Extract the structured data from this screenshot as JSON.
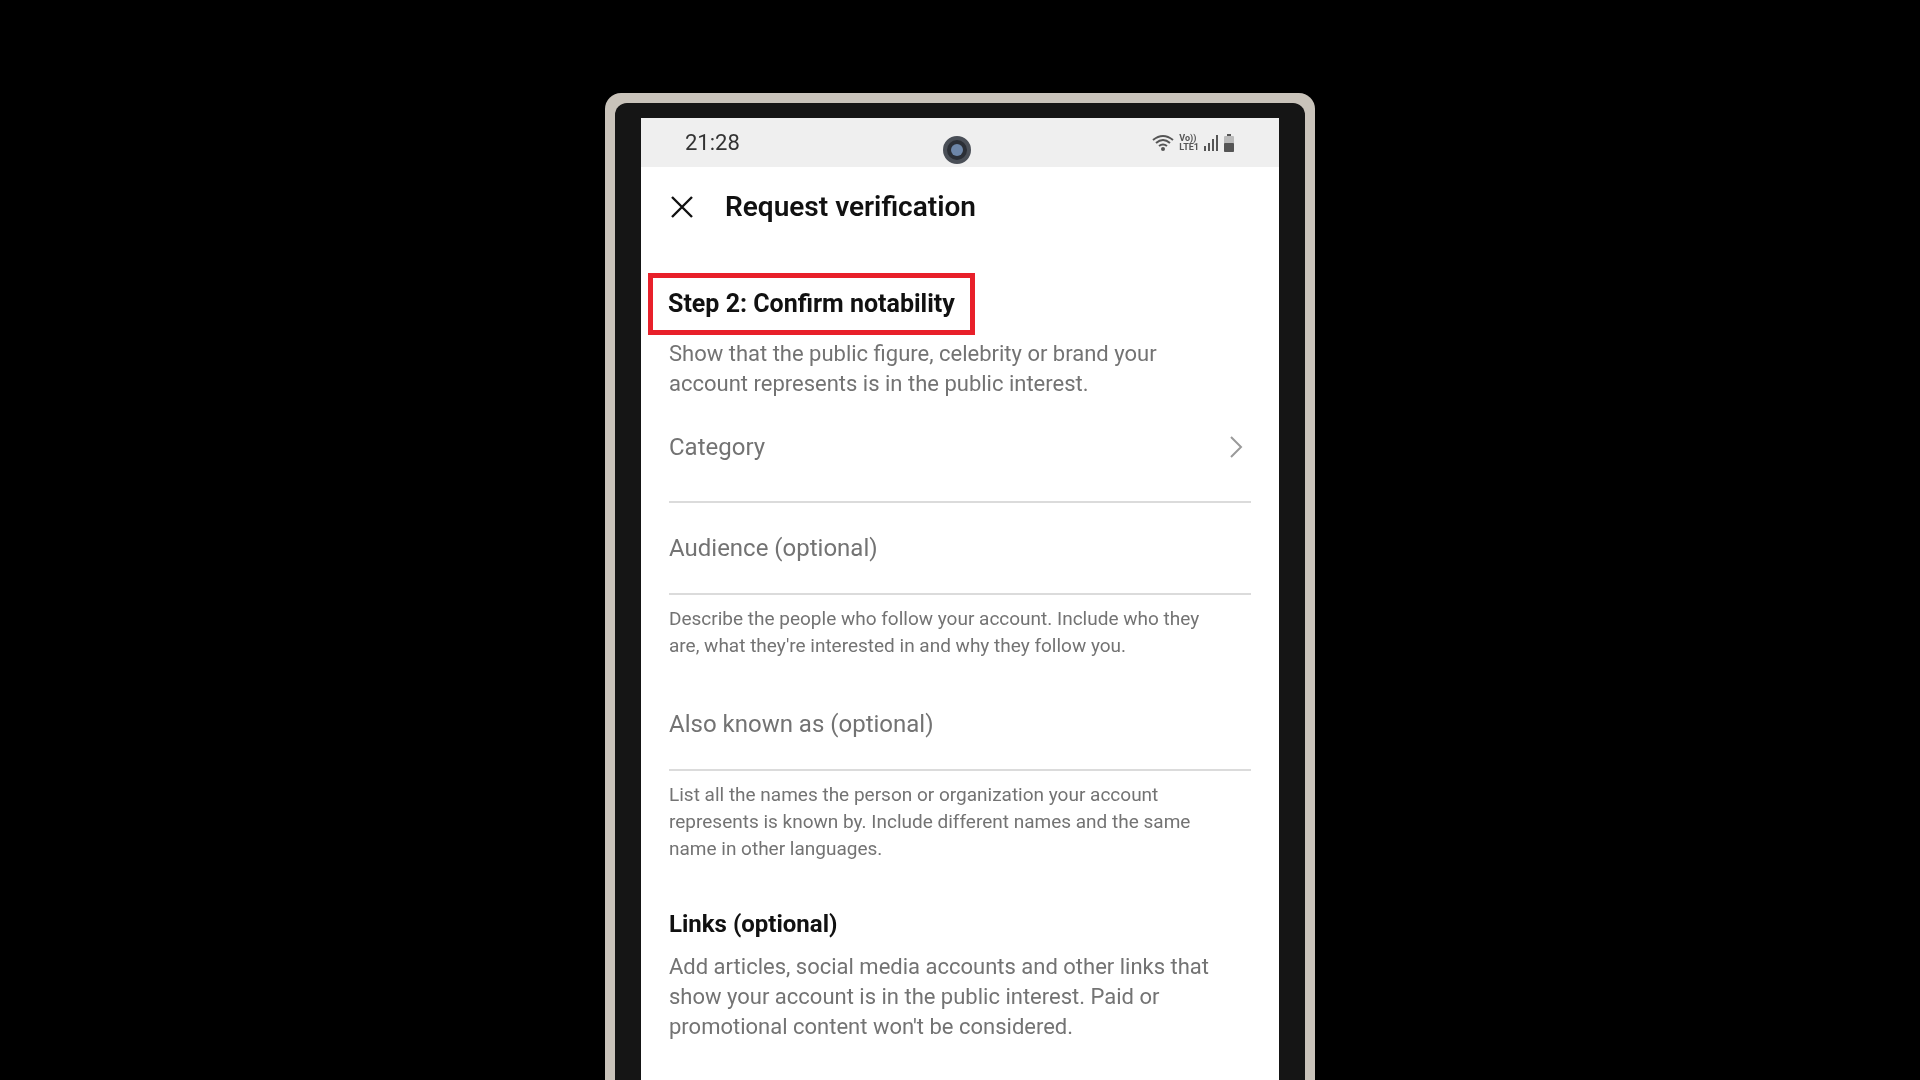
{
  "status_bar": {
    "time": "21:28",
    "network_labels": [
      "Vo))",
      "LTE1"
    ]
  },
  "header": {
    "title": "Request verification"
  },
  "step": {
    "title": "Step 2: Confirm notability",
    "highlighted": true,
    "description": "Show that the public figure, celebrity or brand your account represents is in the public interest."
  },
  "fields": [
    {
      "kind": "select",
      "label": "Category"
    },
    {
      "kind": "text",
      "placeholder": "Audience (optional)",
      "help": "Describe the people who follow your account. Include who they are, what they're interested in and why they follow you."
    },
    {
      "kind": "text",
      "placeholder": "Also known as (optional)",
      "help": "List all the names the person or organization your account represents is known by. Include different names and the same name in other languages."
    }
  ],
  "links_section": {
    "title": "Links (optional)",
    "description": "Add articles, social media accounts and other links that show your account is in the public interest. Paid or promotional content won't be considered."
  }
}
